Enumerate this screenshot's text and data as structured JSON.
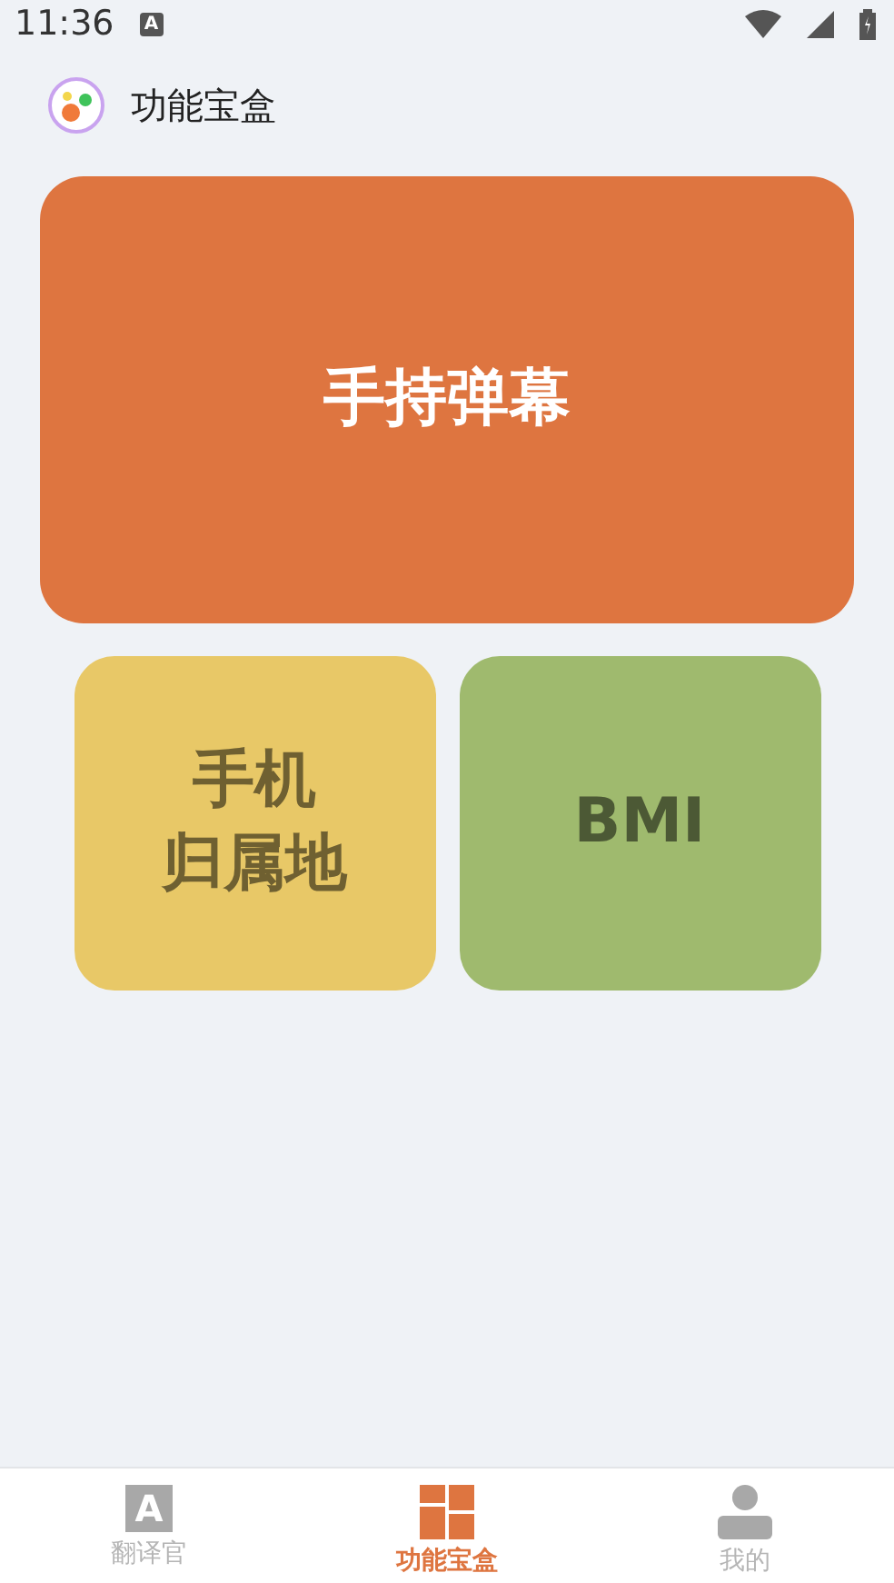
{
  "status_bar": {
    "time": "11:36",
    "notification_glyph": "A"
  },
  "header": {
    "title": "功能宝盒"
  },
  "cards": [
    {
      "kind": "wide",
      "label_lines": [
        "手持弹幕"
      ],
      "color": "#de7540"
    },
    {
      "kind": "tile",
      "label_lines": [
        "手机",
        "归属地"
      ],
      "color": "#e8c867"
    },
    {
      "kind": "tile",
      "label_lines": [
        "BMI"
      ],
      "color": "#9fba6e"
    }
  ],
  "bottom_nav": [
    {
      "kind": "translate",
      "label": "翻译官",
      "icon_glyph": "A",
      "selected": false
    },
    {
      "kind": "toolbox",
      "label": "功能宝盒",
      "selected": true
    },
    {
      "kind": "profile",
      "label": "我的",
      "selected": false
    }
  ]
}
